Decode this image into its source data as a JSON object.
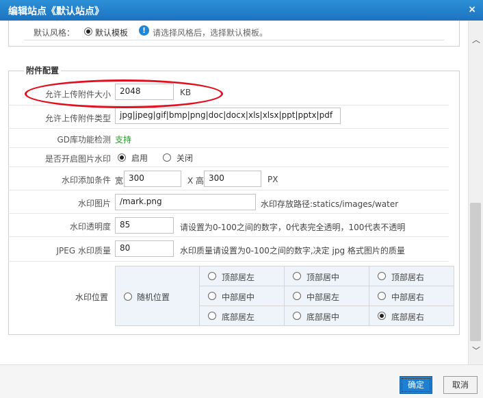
{
  "window": {
    "title": "编辑站点《默认站点》",
    "close_glyph": "×"
  },
  "style_row": {
    "label": "默认风格：",
    "value": "默认模板",
    "info_glyph": "!",
    "hint": "请选择风格后，选择默认模板。"
  },
  "attachment": {
    "legend": "附件配置",
    "max_size": {
      "label": "允许上传附件大小",
      "value": "2048",
      "unit": "KB"
    },
    "allowed_types": {
      "label": "允许上传附件类型",
      "value": "jpg|jpeg|gif|bmp|png|doc|docx|xls|xlsx|ppt|pptx|pdf"
    },
    "gd_check": {
      "label": "GD库功能检测",
      "value": "支持"
    },
    "watermark_enable": {
      "label": "是否开启图片水印",
      "on": "启用",
      "off": "关闭",
      "selected": "启用"
    },
    "watermark_condition": {
      "label": "水印添加条件",
      "width_prefix": "宽",
      "width": "300",
      "x_text": "X 高",
      "height": "300",
      "unit": "PX"
    },
    "watermark_image": {
      "label": "水印图片",
      "value": "/mark.png",
      "hint": "水印存放路径:statics/images/water"
    },
    "watermark_opacity": {
      "label": "水印透明度",
      "value": "85",
      "hint": "请设置为0-100之间的数字，0代表完全透明，100代表不透明"
    },
    "jpeg_quality": {
      "label": "JPEG 水印质量",
      "value": "80",
      "hint": "水印质量请设置为0-100之间的数字,决定 jpg 格式图片的质量"
    },
    "watermark_position": {
      "label": "水印位置",
      "random": "随机位置",
      "grid": [
        [
          "顶部居左",
          "顶部居中",
          "顶部居右"
        ],
        [
          "中部居中",
          "中部居左",
          "中部居右"
        ],
        [
          "底部居左",
          "底部居中",
          "底部居右"
        ]
      ],
      "selected": "底部居右"
    }
  },
  "footer": {
    "ok": "确定",
    "cancel": "取消"
  },
  "colors": {
    "titlebar": "#1d73c0",
    "annotation": "#e0101e",
    "supported": "#2a9a2a",
    "ok_button": "#1f7fd0"
  }
}
